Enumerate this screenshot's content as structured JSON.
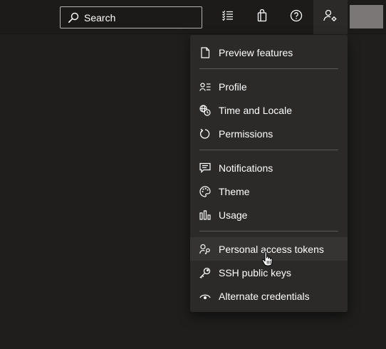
{
  "search": {
    "placeholder": "Search"
  },
  "topbar": {
    "icons": [
      "checklist-icon",
      "shopping-bag-icon",
      "help-icon",
      "user-settings-icon"
    ]
  },
  "user_menu": {
    "sections": [
      {
        "items": [
          {
            "label": "Preview features",
            "icon": "page-icon"
          }
        ]
      },
      {
        "items": [
          {
            "label": "Profile",
            "icon": "profile-card-icon"
          },
          {
            "label": "Time and Locale",
            "icon": "globe-clock-icon"
          },
          {
            "label": "Permissions",
            "icon": "refresh-arrow-icon"
          }
        ]
      },
      {
        "items": [
          {
            "label": "Notifications",
            "icon": "chat-bubble-icon"
          },
          {
            "label": "Theme",
            "icon": "palette-icon"
          },
          {
            "label": "Usage",
            "icon": "bar-chart-icon"
          }
        ]
      },
      {
        "items": [
          {
            "label": "Personal access tokens",
            "icon": "person-key-icon"
          },
          {
            "label": "SSH public keys",
            "icon": "key-icon"
          },
          {
            "label": "Alternate credentials",
            "icon": "eye-icon"
          }
        ]
      }
    ],
    "hovered_item": "Personal access tokens"
  }
}
